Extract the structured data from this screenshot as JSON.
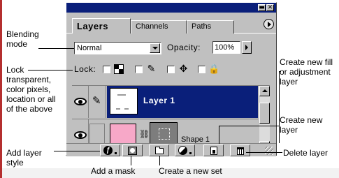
{
  "panel": {
    "tabs": [
      {
        "label": "Layers"
      },
      {
        "label": "Channels"
      },
      {
        "label": "Paths"
      }
    ],
    "window_min": "▬",
    "window_close": "✕",
    "blend_mode": "Normal",
    "opacity_label": "Opacity:",
    "opacity_value": "100%",
    "lock_label": "Lock:",
    "layers": [
      {
        "name": "Layer 1",
        "selected": true,
        "visible": true
      },
      {
        "name": "Shape 1",
        "selected": false,
        "visible": true
      }
    ],
    "bottom_buttons": [
      {
        "icon": "layer-style-icon",
        "glyph": "ƒ"
      },
      {
        "icon": "mask-icon"
      },
      {
        "icon": "folder-icon"
      },
      {
        "icon": "fill-adjustment-icon"
      },
      {
        "icon": "new-layer-icon"
      },
      {
        "icon": "trash-icon"
      }
    ],
    "colors": {
      "titlebar": "#0a1f7a",
      "selected_row": "#0a1f7a",
      "panel_bg": "#c0c0c0",
      "shape_fill": "#f7a8c8"
    }
  },
  "callouts": {
    "blending_mode": "Blending mode",
    "lock": "Lock transparent, color pixels, location or all of the above",
    "add_layer_style": "Add layer style",
    "add_mask": "Add a mask",
    "create_set": "Create a new set",
    "create_fill": "Create new fill or adjustment layer",
    "create_new_layer": "Create new layer",
    "delete_layer": "Delete layer"
  }
}
